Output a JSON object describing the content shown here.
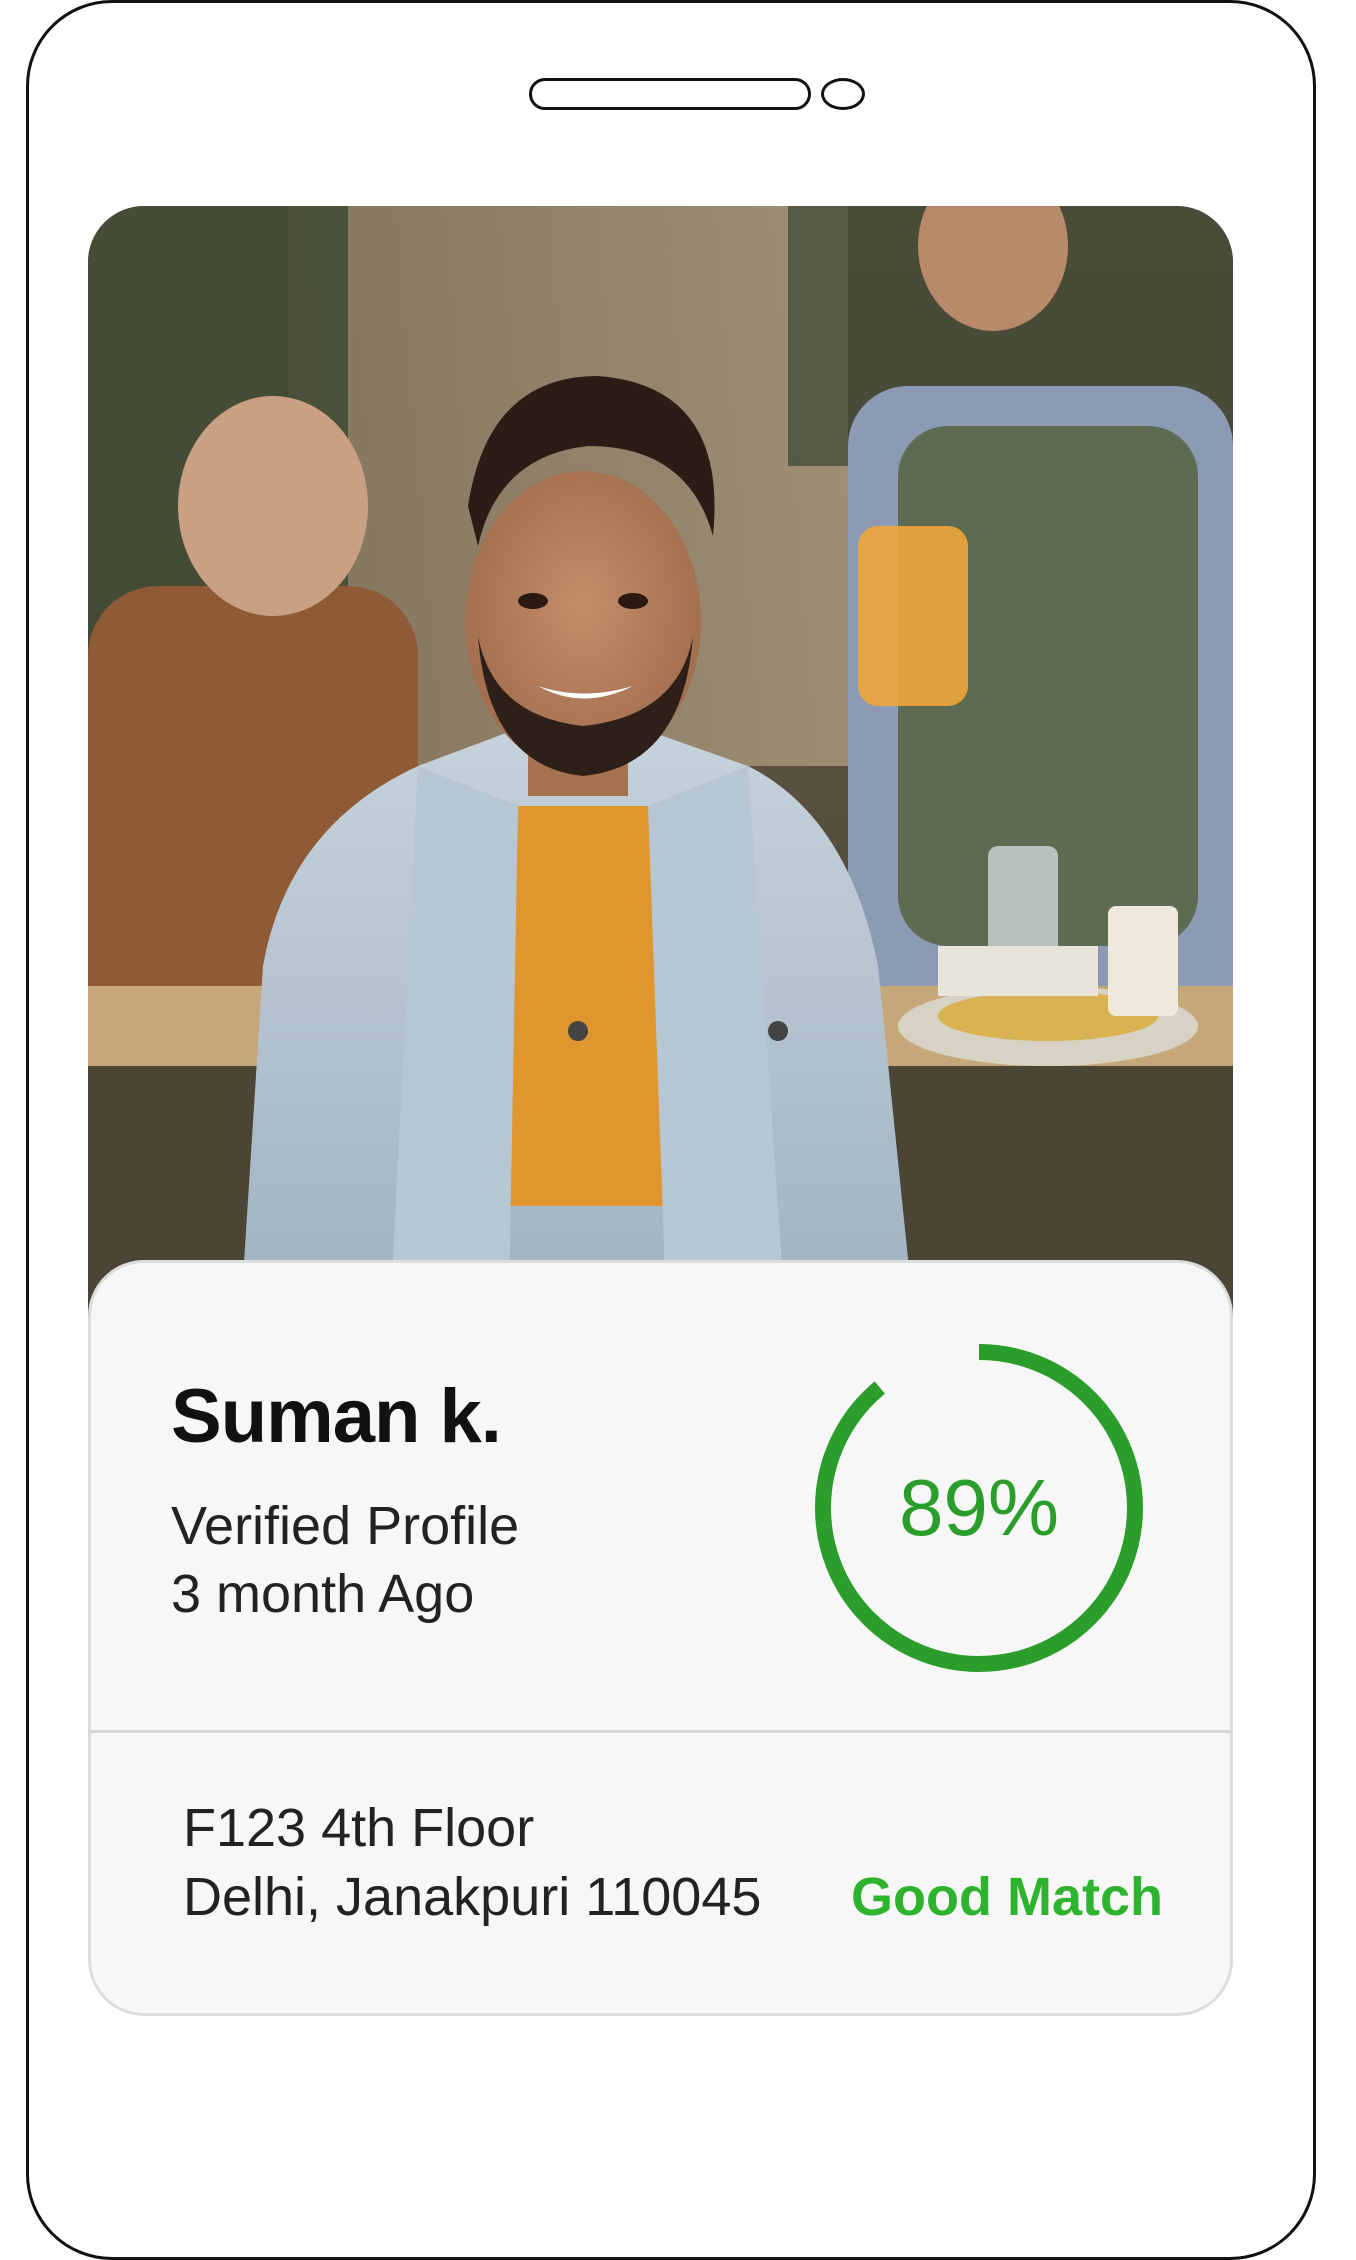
{
  "profile": {
    "name": "Suman k.",
    "status": "Verified Profile",
    "verified_ago": "3 month Ago",
    "photo_alt": "Profile photo",
    "address_line1": "F123 4th Floor",
    "address_line2": "Delhi, Janakpuri 110045"
  },
  "match": {
    "percent_label": "89%",
    "percent_value": 89,
    "label": "Good Match",
    "ring_color": "#2a9d2a",
    "label_color": "#2db32d"
  },
  "icons": {
    "speaker": "speaker-slot-icon",
    "camera": "front-camera-icon"
  }
}
